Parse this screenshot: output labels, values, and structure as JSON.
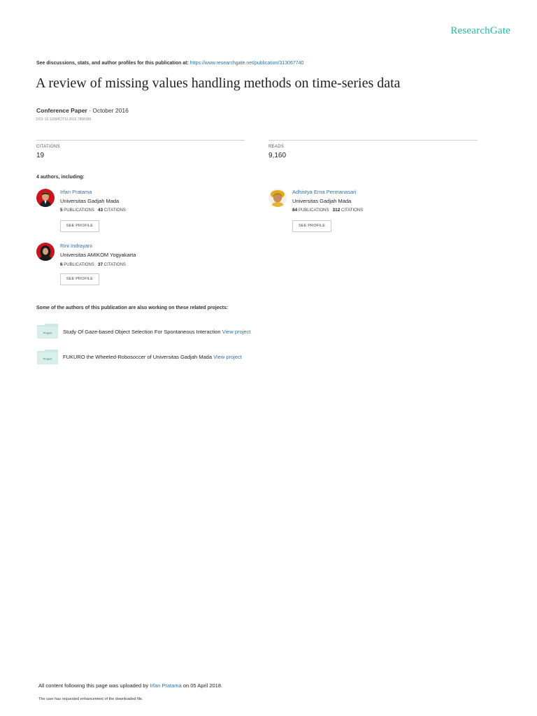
{
  "brand": "ResearchGate",
  "top_line": {
    "text": "See discussions, stats, and author profiles for this publication at:",
    "link": "https://www.researchgate.net/publication/313067740"
  },
  "title": "A review of missing values handling methods on time-series data",
  "meta": {
    "type": "Conference Paper",
    "date": "October 2016"
  },
  "doi": "DOI: 10.1109/ICITSI.2016.7858189",
  "stats": {
    "citations_label": "CITATIONS",
    "citations_value": "19",
    "reads_label": "READS",
    "reads_value": "9,160"
  },
  "authors_heading": "4 authors, including:",
  "authors": [
    {
      "name": "Irfan Pratama",
      "affiliation": "Universitas Gadjah Mada",
      "publications": "5",
      "citations": "43"
    },
    {
      "name": "Adhistya Erna Permanasari",
      "affiliation": "Universitas Gadjah Mada",
      "publications": "84",
      "citations": "312"
    },
    {
      "name": "Rini Indrayani",
      "affiliation": "Universitas AMIKOM Yogyakarta",
      "publications": "6",
      "citations": "37"
    }
  ],
  "labels": {
    "publications": "PUBLICATIONS",
    "citations": "CITATIONS",
    "see_profile": "SEE PROFILE"
  },
  "projects_heading": "Some of the authors of this publication are also working on these related projects:",
  "projects": [
    {
      "icon_text": "Project",
      "title": "Study Of Gaze-based Object Selection For Spontaneous Interaction",
      "link": "View project"
    },
    {
      "icon_text": "Project",
      "title": "FUKURO the Wheeled-Robosoccer of Universitas Gadjah Mada",
      "link": "View project"
    }
  ],
  "footer": {
    "prefix": "All content following this page was uploaded by",
    "uploader": "Irfan Pratama",
    "suffix": "on 05 April 2018.",
    "note": "The user has requested enhancement of the downloaded file."
  },
  "colors": {
    "brand": "#2ab7a9",
    "link": "#2f6fa5",
    "project_icon": "#cfe9e4"
  }
}
